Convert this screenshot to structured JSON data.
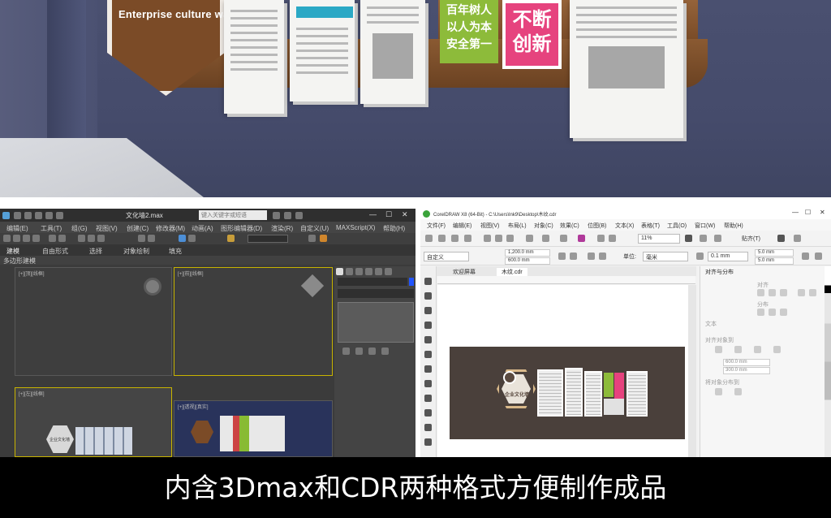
{
  "render": {
    "wall_title_en": "Enterprise culture wall",
    "sign_green_lines": [
      "百年树人",
      "以人为本",
      "安全第一"
    ],
    "sign_pink_lines": [
      "不断",
      "创新"
    ]
  },
  "max_app": {
    "file_title": "文化墙2.max",
    "search_placeholder": "键入关键字或短语",
    "menu_items": [
      "编辑(E)",
      "工具(T)",
      "组(G)",
      "视图(V)",
      "创建(C)",
      "修改器(M)",
      "动画(A)",
      "图形编辑器(D)",
      "渲染(R)",
      "自定义(U)",
      "MAXScript(X)",
      "帮助(H)"
    ],
    "ribbon_tabs": [
      "建模",
      "自由形式",
      "选择",
      "对象绘制",
      "填充"
    ],
    "sub_label": "多边形建模",
    "viewport_labels": [
      "[+][顶][线框]",
      "[+][前][线框]",
      "[+][左][线框]",
      "[+][透视][真实]"
    ],
    "logo_text": "企业文化墙"
  },
  "cdr_app": {
    "title": "CorelDRAW X8 (64-Bit) - C:\\Users\\lnk9\\Desktop\\木纹.cdr",
    "menu_items": [
      "文件(F)",
      "编辑(E)",
      "视图(V)",
      "布局(L)",
      "对象(C)",
      "效果(C)",
      "位图(B)",
      "文本(X)",
      "表格(T)",
      "工具(O)",
      "窗口(W)",
      "帮助(H)"
    ],
    "zoom": "11%",
    "snap_label": "贴齐(T)",
    "page_preset": "自定义",
    "width_value": "1,200.0 mm",
    "height_value": "600.0 mm",
    "units_label": "单位:",
    "units_value": "毫米",
    "nudge_value": "0.1 mm",
    "dup_x": "5.0 mm",
    "dup_y": "5.0 mm",
    "tabs": [
      "欢迎屏幕",
      "木纹.cdr"
    ],
    "docker_title": "对齐与分布",
    "docker_sections": [
      "对齐",
      "分布",
      "文本",
      "对齐对象到",
      "将对象分布到"
    ],
    "pos_x": "600.0 mm",
    "pos_y": "300.0 mm",
    "logo_text": "企业文化墙"
  },
  "caption": "内含3Dmax和CDR两种格式方便制作成品",
  "colors": {
    "wall": "#474d6d",
    "wood": "#7b4b27",
    "green_sign": "#8dbb3a",
    "pink_sign": "#e6437e",
    "max_bg": "#3b3b3b",
    "cdr_design_bg": "#4a403b"
  }
}
